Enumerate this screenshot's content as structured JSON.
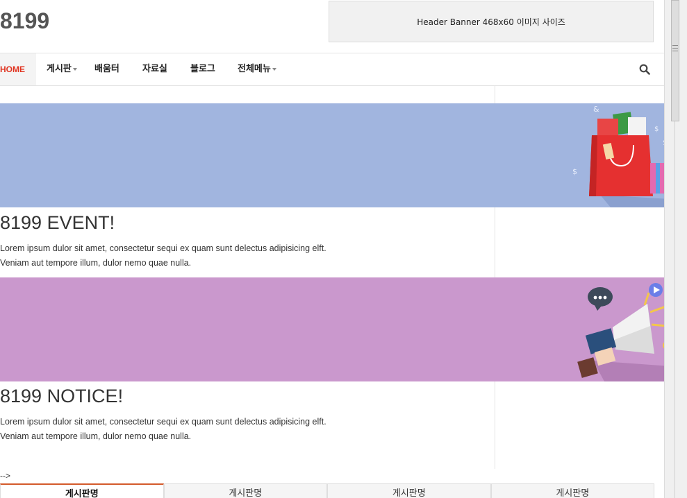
{
  "site": {
    "title": "8199"
  },
  "header": {
    "banner_text": "Header Banner 468x60 이미지 사이즈"
  },
  "nav": {
    "items": [
      {
        "label": "HOME",
        "active": true,
        "has_dropdown": false
      },
      {
        "label": "게시판",
        "has_dropdown": true
      },
      {
        "label": "배움터",
        "has_dropdown": false
      },
      {
        "label": "자료실",
        "has_dropdown": false
      },
      {
        "label": "블로그",
        "has_dropdown": false
      },
      {
        "label": "전체메뉴",
        "has_dropdown": true
      }
    ],
    "search_icon": "search-icon"
  },
  "posts": [
    {
      "title": "8199 EVENT!",
      "line1": "Lorem ipsum dulor sit amet, consectetur sequi ex quam sunt delectus adipisicing elft.",
      "line2": "Veniam aut tempore illum, dulor nemo quae nulla.",
      "banner_color": "#a1b5df",
      "banner_icon": "shopping-bag-icon"
    },
    {
      "title": "8199 NOTICE!",
      "line1": "Lorem ipsum dulor sit amet, consectetur sequi ex quam sunt delectus adipisicing elft.",
      "line2": "Veniam aut tempore illum, dulor nemo quae nulla.",
      "banner_color": "#ca98cd",
      "banner_icon": "megaphone-icon"
    }
  ],
  "stray_text": "-->",
  "board_tabs": [
    {
      "label": "게시판명",
      "active": true
    },
    {
      "label": "게시판명",
      "active": false
    },
    {
      "label": "게시판명",
      "active": false
    },
    {
      "label": "게시판명",
      "active": false
    }
  ],
  "colors": {
    "accent": "#e0321e",
    "tab_accent": "#d35a2a"
  }
}
